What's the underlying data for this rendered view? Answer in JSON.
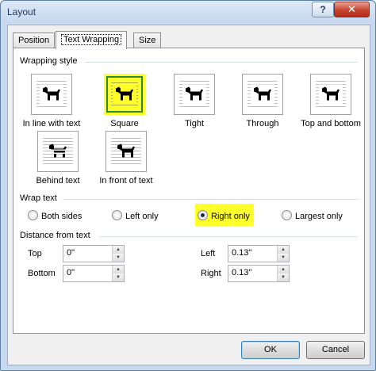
{
  "window": {
    "title": "Layout",
    "help_label": "?",
    "close_label": "✕"
  },
  "tabs": [
    {
      "label": "Position",
      "active": false
    },
    {
      "label": "Text Wrapping",
      "active": true
    },
    {
      "label": "Size",
      "active": false
    }
  ],
  "wrapping_style": {
    "label": "Wrapping style",
    "options": [
      {
        "label": "In line with text",
        "selected": false
      },
      {
        "label": "Square",
        "selected": true
      },
      {
        "label": "Tight",
        "selected": false
      },
      {
        "label": "Through",
        "selected": false
      },
      {
        "label": "Top and bottom",
        "selected": false
      },
      {
        "label": "Behind text",
        "selected": false
      },
      {
        "label": "In front of text",
        "selected": false
      }
    ]
  },
  "wrap_text": {
    "label": "Wrap text",
    "options": [
      {
        "label": "Both sides",
        "checked": false
      },
      {
        "label": "Left only",
        "checked": false
      },
      {
        "label": "Right only",
        "checked": true
      },
      {
        "label": "Largest only",
        "checked": false
      }
    ]
  },
  "distance": {
    "label": "Distance from text",
    "top": {
      "label": "Top",
      "value": "0\""
    },
    "bottom": {
      "label": "Bottom",
      "value": "0\""
    },
    "left": {
      "label": "Left",
      "value": "0.13\""
    },
    "right": {
      "label": "Right",
      "value": "0.13\""
    }
  },
  "buttons": {
    "ok": "OK",
    "cancel": "Cancel"
  },
  "colors": {
    "highlight": "#ffff2b",
    "selected_border": "#2d8a3c"
  },
  "icons": {
    "wrap_icon": "dog-silhouette-icon",
    "radio": "radio-button",
    "spinner": "spin-arrows"
  }
}
